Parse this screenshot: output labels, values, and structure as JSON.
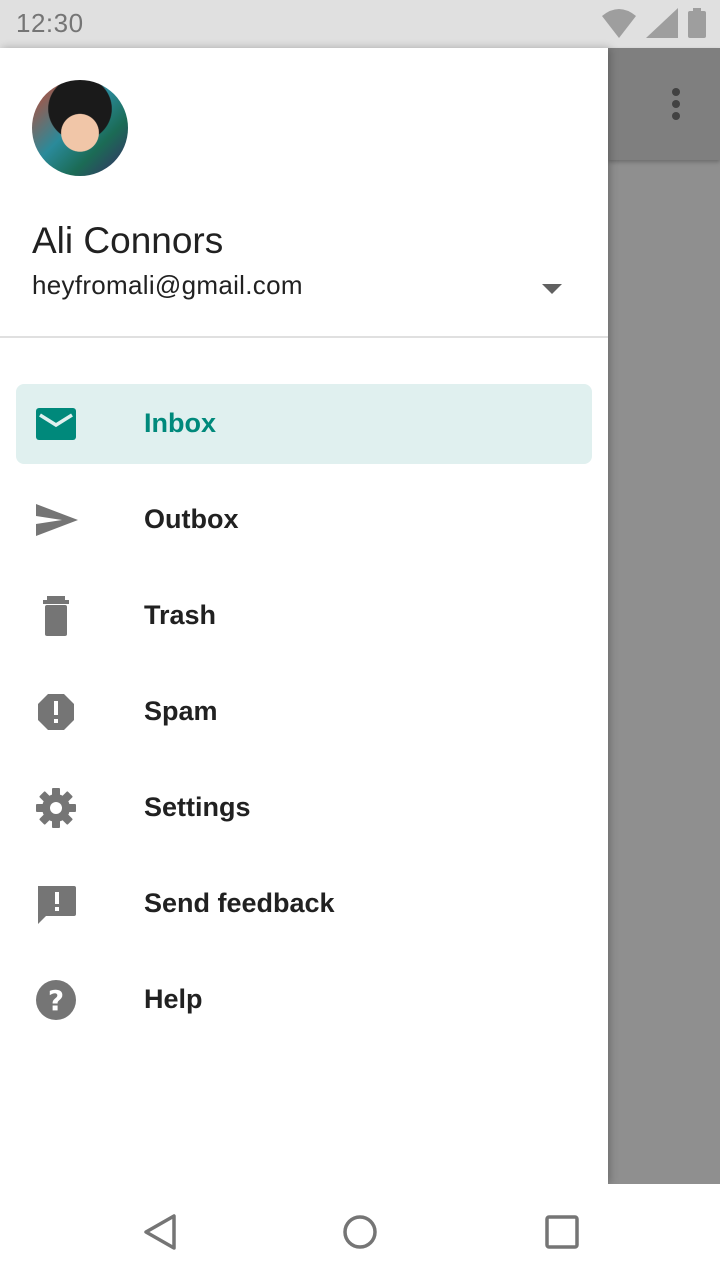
{
  "status_bar": {
    "time": "12:30",
    "icons": [
      "wifi-icon",
      "signal-icon",
      "battery-icon"
    ]
  },
  "background_app": {
    "overflow_icon": "more-vert-icon",
    "scrim_color": "#8f8f8f"
  },
  "drawer": {
    "user": {
      "name": "Ali Connors",
      "email": "heyfromali@gmail.com",
      "dropdown_icon": "arrow-drop-down-icon"
    },
    "items": [
      {
        "label": "Inbox",
        "icon": "inbox-icon",
        "active": true
      },
      {
        "label": "Outbox",
        "icon": "send-icon",
        "active": false
      },
      {
        "label": "Trash",
        "icon": "delete-icon",
        "active": false
      },
      {
        "label": "Spam",
        "icon": "report-icon",
        "active": false
      },
      {
        "label": "Settings",
        "icon": "settings-icon",
        "active": false
      },
      {
        "label": "Send feedback",
        "icon": "feedback-icon",
        "active": false
      },
      {
        "label": "Help",
        "icon": "help-icon",
        "active": false
      }
    ],
    "accent_color": "#00897b",
    "active_bg_color": "#e0f0ef"
  },
  "system_nav": {
    "buttons": [
      "back-icon",
      "home-icon",
      "recents-icon"
    ]
  }
}
